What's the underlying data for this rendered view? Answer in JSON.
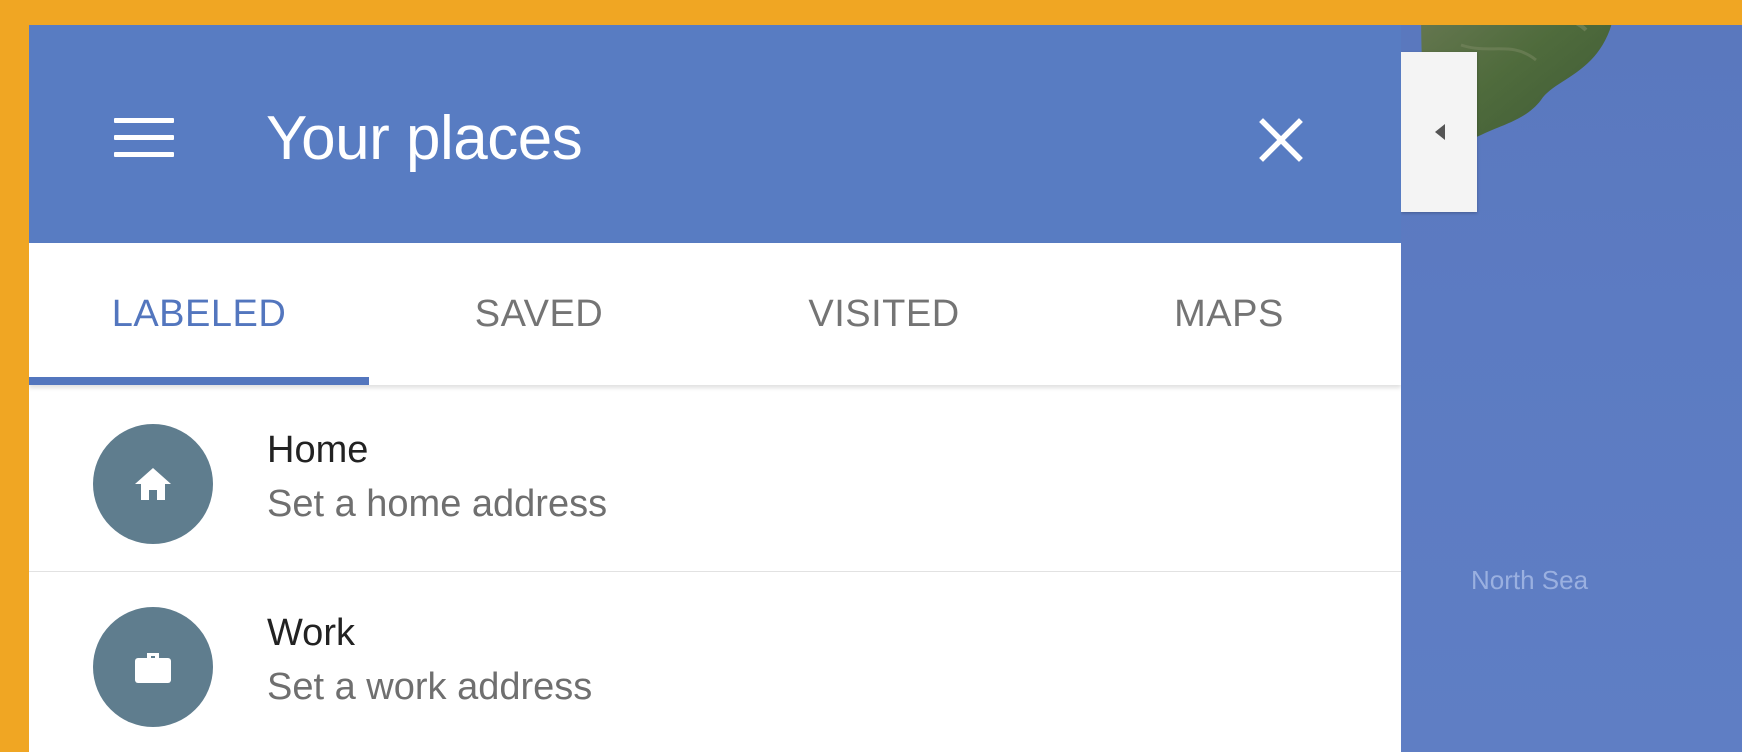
{
  "header": {
    "title": "Your places",
    "menu_icon": "menu-icon",
    "close_icon": "close-icon",
    "color": "#587CC2"
  },
  "tabs": [
    {
      "label": "LABELED",
      "active": true
    },
    {
      "label": "SAVED",
      "active": false
    },
    {
      "label": "VISITED",
      "active": false
    },
    {
      "label": "MAPS",
      "active": false
    }
  ],
  "items": [
    {
      "name": "Home",
      "subtitle": "Set a home address",
      "icon": "home-icon"
    },
    {
      "name": "Work",
      "subtitle": "Set a work address",
      "icon": "briefcase-icon"
    }
  ],
  "map": {
    "label": "North Sea",
    "collapse_icon": "caret-left-icon"
  },
  "colors": {
    "accent": "#5376BE",
    "frame": "#F0A623",
    "avatar": "#5F7D8E",
    "sea": "#5C79C0"
  }
}
